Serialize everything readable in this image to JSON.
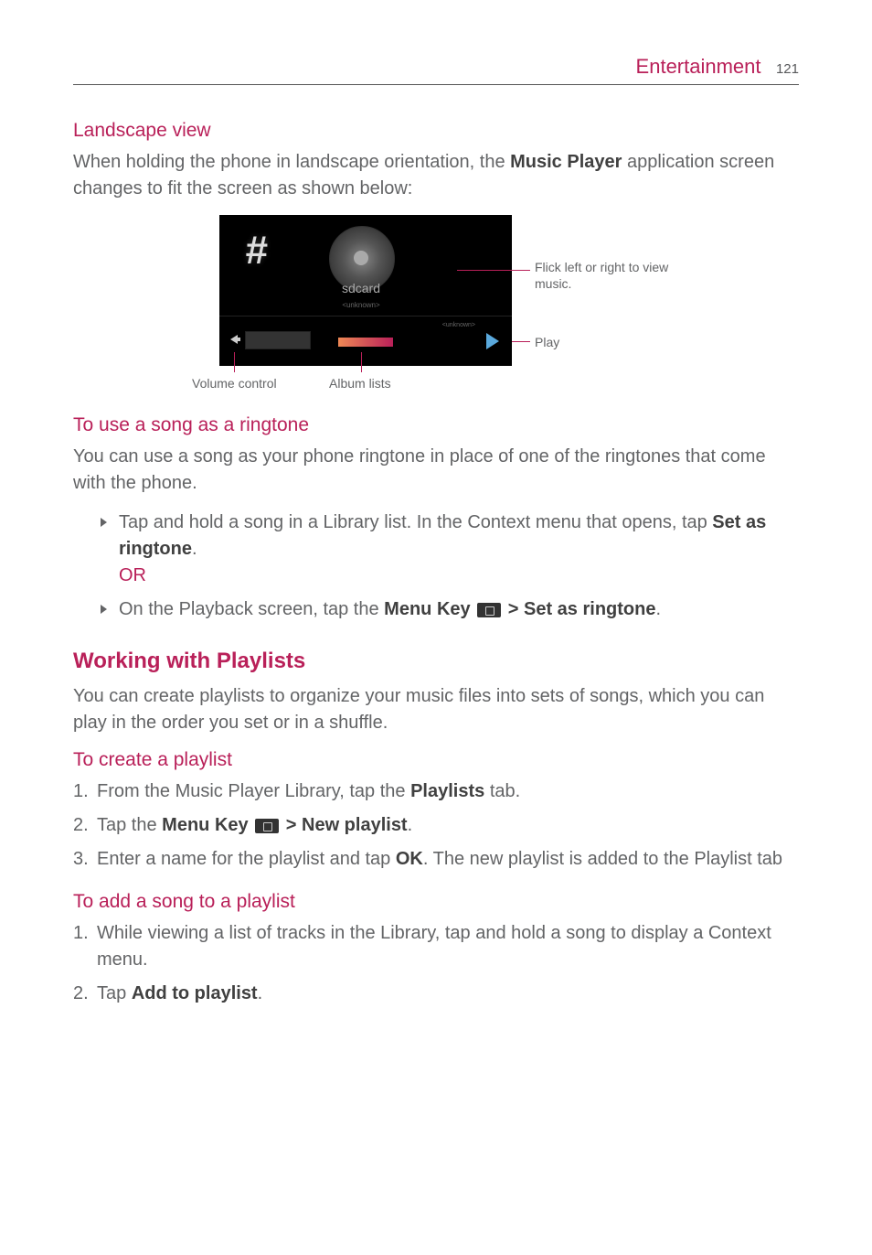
{
  "header": {
    "title": "Entertainment",
    "page": "121"
  },
  "section1": {
    "heading": "Landscape view",
    "p1a": "When holding the phone in landscape orientation, the ",
    "p1b": "Music Player",
    "p1c": " application screen changes to fit the screen as shown below:"
  },
  "figure": {
    "sdcard": "sdcard",
    "sdcard_sub": "<unknown>",
    "unknown": "<unknown>",
    "callout_flick": "Flick left or right to view music.",
    "callout_play": "Play",
    "callout_volume": "Volume control",
    "callout_album": "Album lists"
  },
  "section2": {
    "heading": "To use a song as a ringtone",
    "p": "You can use a song as your phone ringtone in place of one of the ringtones that come with the phone.",
    "bullet1a": "Tap and hold a song in a Library list. In the Context menu that opens, tap ",
    "bullet1b": "Set as ringtone",
    "bullet1c": ".",
    "or": "OR",
    "bullet2a": "On the Playback screen, tap the ",
    "bullet2b": "Menu Key",
    "bullet2c": " > ",
    "bullet2d": "Set as ringtone",
    "bullet2e": "."
  },
  "section3": {
    "heading": "Working with Playlists",
    "p": "You can create playlists to organize your music files into sets of songs, which you can play in the order you set or in a shuffle."
  },
  "section4": {
    "heading": "To create a playlist",
    "li1a": "From the Music Player Library, tap the ",
    "li1b": "Playlists",
    "li1c": " tab.",
    "li2a": "Tap the ",
    "li2b": "Menu Key",
    "li2c": " > ",
    "li2d": "New playlist",
    "li2e": ".",
    "li3a": "Enter a name for the playlist and tap ",
    "li3b": "OK",
    "li3c": ". The new playlist is added to the Playlist tab"
  },
  "section5": {
    "heading": "To add a song to a playlist",
    "li1": "While viewing a list of tracks in the Library, tap and hold a song to display a Context menu.",
    "li2a": "Tap ",
    "li2b": "Add to playlist",
    "li2c": "."
  }
}
